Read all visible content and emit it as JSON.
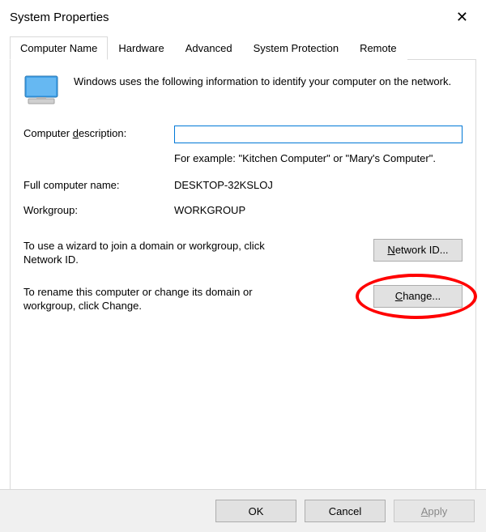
{
  "title": "System Properties",
  "close_label": "✕",
  "tabs": [
    {
      "label": "Computer Name"
    },
    {
      "label": "Hardware"
    },
    {
      "label": "Advanced"
    },
    {
      "label": "System Protection"
    },
    {
      "label": "Remote"
    }
  ],
  "intro": "Windows uses the following information to identify your computer on the network.",
  "desc_label_pre": "Computer ",
  "desc_label_u": "d",
  "desc_label_post": "escription:",
  "desc_value": "",
  "desc_hint": "For example: \"Kitchen Computer\" or \"Mary's Computer\".",
  "fullname_label": "Full computer name:",
  "fullname_value": "DESKTOP-32KSLOJ",
  "workgroup_label": "Workgroup:",
  "workgroup_value": "WORKGROUP",
  "wizard_text": "To use a wizard to join a domain or workgroup, click Network ID.",
  "network_id_u": "N",
  "network_id_post": "etwork ID...",
  "change_text": "To rename this computer or change its domain or workgroup, click Change.",
  "change_u": "C",
  "change_post": "hange...",
  "ok_label": "OK",
  "cancel_label": "Cancel",
  "apply_u": "A",
  "apply_post": "pply"
}
